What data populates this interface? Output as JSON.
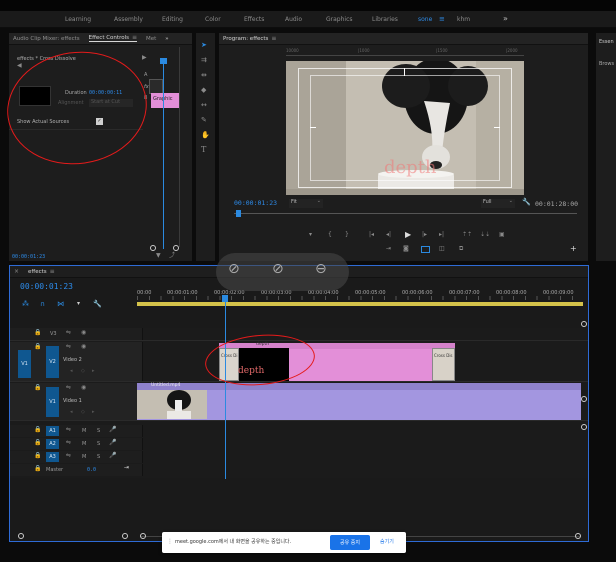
{
  "workspaces": {
    "items": [
      "Learning",
      "Assembly",
      "Editing",
      "Color",
      "Effects",
      "Audio",
      "Graphics",
      "Libraries",
      "sone",
      "khm"
    ],
    "more": "»"
  },
  "effect_controls": {
    "tabs": [
      "Audio Clip Mixer: effects",
      "Effect Controls",
      "Met"
    ],
    "more": "»",
    "clip_label": "effects * Cross Dissolve",
    "duration_label": "Duration",
    "duration_value": "00:00:00:11",
    "alignment_label": "Alignment",
    "alignment_value": "Start at Cut",
    "show_sources_label": "Show Actual Sources",
    "a_label": "A",
    "b_label": "B",
    "graphic_label": "Graphic",
    "timecode": "00:00:01:23"
  },
  "program": {
    "title": "Program: effects",
    "ruler_marks": [
      "10000",
      "|1000",
      "|1500",
      "|2000"
    ],
    "current_tc": "00:00:01:23",
    "fit_label": "Fit",
    "quality_label": "Full",
    "duration_tc": "00:01:28:00",
    "watermark": "depth"
  },
  "right_panel": {
    "labels": [
      "Essen",
      "Brows"
    ]
  },
  "timeline": {
    "title": "effects",
    "timecode": "00:00:01:23",
    "ruler": [
      "00:00",
      "00:00:01:00",
      "00:00:02:00",
      "00:00:03:00",
      "00:00:04:00",
      "00:00:05:00",
      "00:00:06:00",
      "00:00:07:00",
      "00:00:08:00",
      "00:00:09:00"
    ],
    "tracks": {
      "v3": "V3",
      "v2": "V2",
      "v2_name": "Video 2",
      "v1": "V1",
      "v1_src": "V1",
      "v1_name": "Video 1",
      "a1": "A1",
      "a2": "A2",
      "a3": "A3",
      "master": "Master",
      "master_value": "0.0",
      "m_label": "M",
      "s_label": "S"
    },
    "clips": {
      "graphic": "depth",
      "cross1": "Cross Di",
      "cross2": "Cross Dis",
      "video": "Untitled.mp4",
      "overlay_text": "depth"
    }
  },
  "share_bar": {
    "message": "meet.google.com에서 내 화면을 공유하는 중입니다.",
    "stop_label": "공유 중지",
    "hide_label": "숨기기"
  },
  "colors": {
    "accent": "#2b8ae0",
    "graphic_clip": "#e38fd8",
    "video_clip": "#a396e0",
    "annotation": "#e41b1b",
    "stop_button": "#1a73e8"
  }
}
